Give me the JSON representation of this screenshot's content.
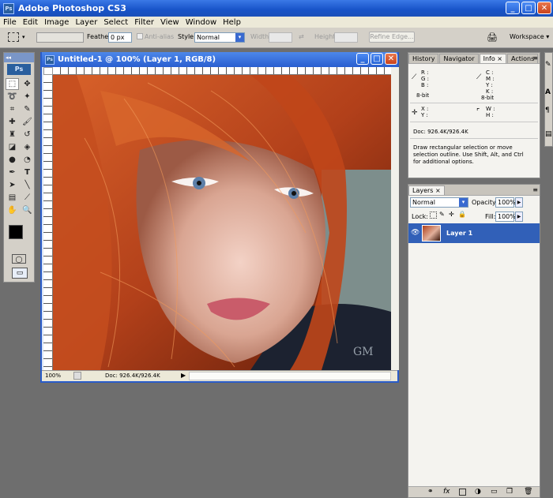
{
  "app": {
    "title": "Adobe Photoshop CS3"
  },
  "menu": [
    "File",
    "Edit",
    "Image",
    "Layer",
    "Select",
    "Filter",
    "View",
    "Window",
    "Help"
  ],
  "options": {
    "feather_label": "Feather:",
    "feather_value": "0 px",
    "antialias_label": "Anti-alias",
    "style_label": "Style:",
    "style_value": "Normal",
    "width_label": "Width:",
    "height_label": "Height:",
    "refine_edge": "Refine Edge...",
    "workspace": "Workspace"
  },
  "toolbox": {
    "logo": "Ps"
  },
  "document": {
    "title": "Untitled-1 @ 100% (Layer 1, RGB/8)",
    "zoom": "100%",
    "doc_size": "Doc: 926.4K/926.4K",
    "watermark": "GM"
  },
  "info_panel": {
    "tabs": [
      "History",
      "Navigator",
      "Info",
      "Actions"
    ],
    "active_tab": "Info",
    "rgb_labels": [
      "R :",
      "G :",
      "B :"
    ],
    "cmyk_labels": [
      "C :",
      "M :",
      "Y :",
      "K :"
    ],
    "bit_left": "8-bit",
    "bit_right": "8-bit",
    "xy_labels": [
      "X :",
      "Y :"
    ],
    "wh_labels": [
      "W :",
      "H :"
    ],
    "doc_size": "Doc: 926.4K/926.4K",
    "hint": "Draw rectangular selection or move selection outline.  Use Shift, Alt, and Ctrl for additional options."
  },
  "layers_panel": {
    "tab": "Layers",
    "blend_mode": "Normal",
    "opacity_label": "Opacity:",
    "opacity_value": "100%",
    "lock_label": "Lock:",
    "fill_label": "Fill:",
    "fill_value": "100%",
    "layers": [
      {
        "name": "Layer 1",
        "selected": true
      }
    ]
  },
  "colors": {
    "accent": "#2a5cc8",
    "layer_selected": "#3160b8",
    "hair": "#b2401a"
  }
}
